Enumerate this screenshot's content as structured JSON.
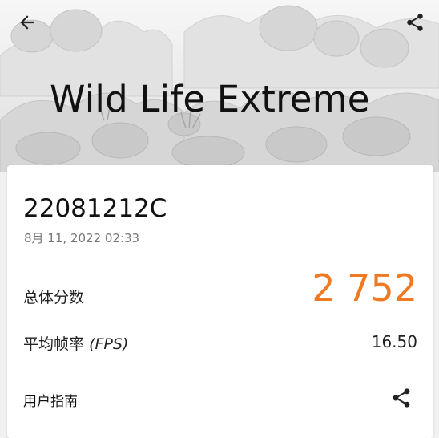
{
  "header": {
    "title": "Wild Life Extreme",
    "back_icon": "arrow-left-icon",
    "share_icon": "share-icon"
  },
  "result": {
    "device": "22081212C",
    "date": "8月 11, 2022 02:33",
    "total_score_label": "总体分数",
    "total_score": "2 752",
    "fps_label": "平均帧率",
    "fps_unit": "(FPS)",
    "fps_value": "16.50",
    "guide_label": "用户指南",
    "guide_share_icon": "share-icon"
  },
  "colors": {
    "score": "#f07a24",
    "text": "#111111",
    "secondary": "#777777"
  }
}
